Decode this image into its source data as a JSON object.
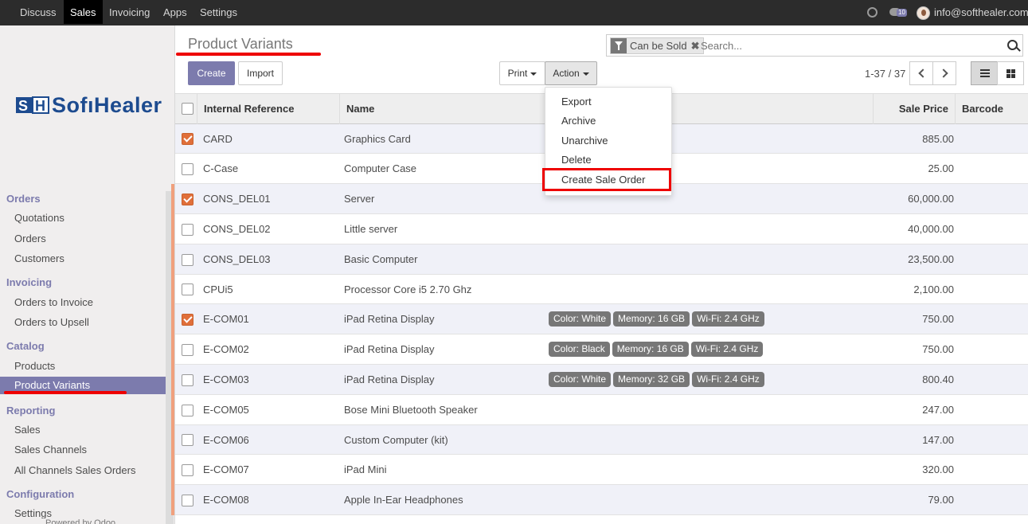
{
  "navbar": {
    "menu": [
      "Discuss",
      "Sales",
      "Invoicing",
      "Apps",
      "Settings"
    ],
    "active": "Sales",
    "message_count": "10",
    "user_email": "info@softhealer.com"
  },
  "sidebar": {
    "logo_text": "SofıHealer",
    "sections": [
      {
        "title": "Orders",
        "items": [
          "Quotations",
          "Orders",
          "Customers"
        ]
      },
      {
        "title": "Invoicing",
        "items": [
          "Orders to Invoice",
          "Orders to Upsell"
        ]
      },
      {
        "title": "Catalog",
        "items": [
          "Products",
          "Product Variants"
        ]
      },
      {
        "title": "Reporting",
        "items": [
          "Sales",
          "Sales Channels",
          "All Channels Sales Orders"
        ]
      },
      {
        "title": "Configuration",
        "items": [
          "Settings"
        ]
      }
    ],
    "active_item": "Product Variants",
    "footer": "Powered by Odoo"
  },
  "control_panel": {
    "title": "Product Variants",
    "create_label": "Create",
    "import_label": "Import",
    "print_label": "Print",
    "action_label": "Action",
    "search": {
      "facet": "Can be Sold",
      "placeholder": "Search..."
    },
    "pager": "1-37 / 37"
  },
  "action_menu": {
    "items": [
      "Export",
      "Archive",
      "Unarchive",
      "Delete",
      "Create Sale Order"
    ],
    "highlighted": "Create Sale Order"
  },
  "table": {
    "columns": [
      "Internal Reference",
      "Name",
      "Sale Price",
      "Barcode"
    ],
    "rows": [
      {
        "ref": "CARD",
        "name": "Graphics Card",
        "tags": [],
        "price": "885.00",
        "checked": true
      },
      {
        "ref": "C-Case",
        "name": "Computer Case",
        "tags": [],
        "price": "25.00",
        "checked": false
      },
      {
        "ref": "CONS_DEL01",
        "name": "Server",
        "tags": [],
        "price": "60,000.00",
        "checked": true
      },
      {
        "ref": "CONS_DEL02",
        "name": "Little server",
        "tags": [],
        "price": "40,000.00",
        "checked": false
      },
      {
        "ref": "CONS_DEL03",
        "name": "Basic Computer",
        "tags": [],
        "price": "23,500.00",
        "checked": false
      },
      {
        "ref": "CPUi5",
        "name": "Processor Core i5 2.70 Ghz",
        "tags": [],
        "price": "2,100.00",
        "checked": false
      },
      {
        "ref": "E-COM01",
        "name": "iPad Retina Display",
        "tags": [
          "Color: White",
          "Memory: 16 GB",
          "Wi-Fi: 2.4 GHz"
        ],
        "price": "750.00",
        "checked": true
      },
      {
        "ref": "E-COM02",
        "name": "iPad Retina Display",
        "tags": [
          "Color: Black",
          "Memory: 16 GB",
          "Wi-Fi: 2.4 GHz"
        ],
        "price": "750.00",
        "checked": false
      },
      {
        "ref": "E-COM03",
        "name": "iPad Retina Display",
        "tags": [
          "Color: White",
          "Memory: 32 GB",
          "Wi-Fi: 2.4 GHz"
        ],
        "price": "800.40",
        "checked": false
      },
      {
        "ref": "E-COM05",
        "name": "Bose Mini Bluetooth Speaker",
        "tags": [],
        "price": "247.00",
        "checked": false
      },
      {
        "ref": "E-COM06",
        "name": "Custom Computer (kit)",
        "tags": [],
        "price": "147.00",
        "checked": false
      },
      {
        "ref": "E-COM07",
        "name": "iPad Mini",
        "tags": [],
        "price": "320.00",
        "checked": false
      },
      {
        "ref": "E-COM08",
        "name": "Apple In-Ear Headphones",
        "tags": [],
        "price": "79.00",
        "checked": false
      }
    ]
  }
}
